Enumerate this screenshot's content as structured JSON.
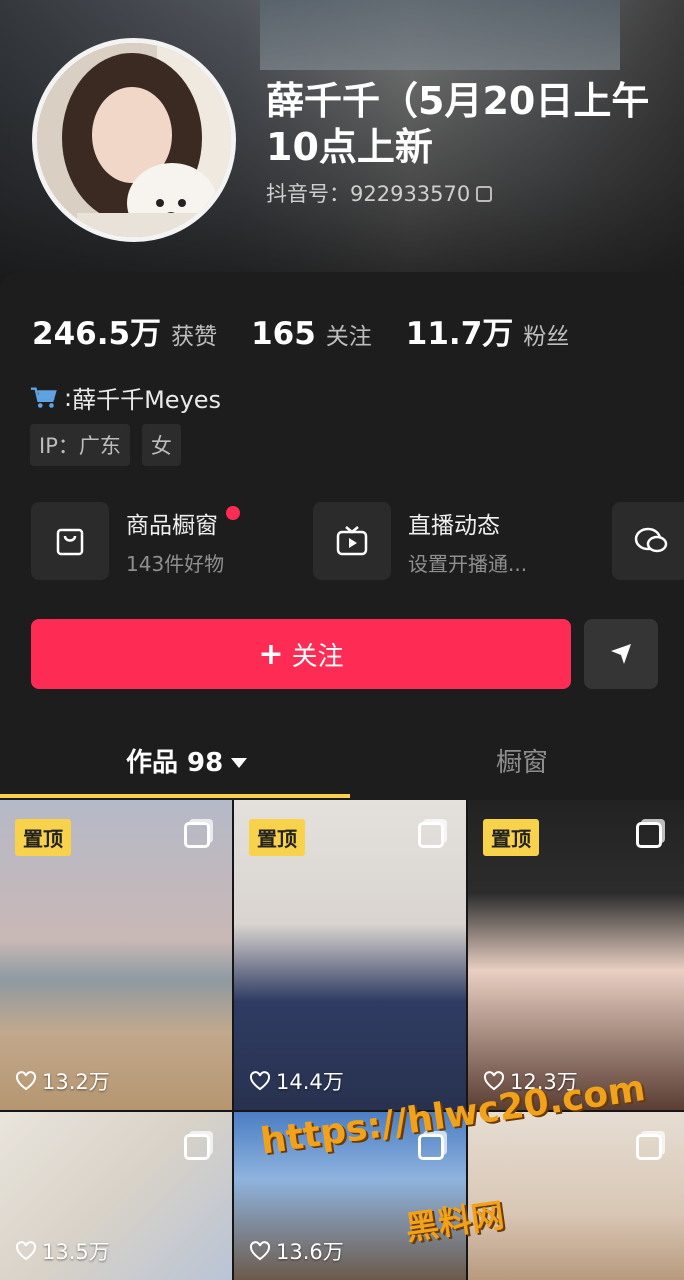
{
  "profile": {
    "name": "薛千千（5月20日上午10点上新",
    "douyin_id": "抖音号：922933570"
  },
  "stats": [
    {
      "value": "246.5万",
      "label": "获赞"
    },
    {
      "value": "165",
      "label": "关注"
    },
    {
      "value": "11.7万",
      "label": "粉丝"
    }
  ],
  "shop": {
    "prefix": ": ",
    "name": "薛千千Meyes"
  },
  "tags": [
    "IP：广东",
    "女"
  ],
  "cards": [
    {
      "title": "商品橱窗",
      "subtitle": "143件好物",
      "icon": "shopping-bag-icon"
    },
    {
      "title": "直播动态",
      "subtitle": "设置开播通...",
      "icon": "tv-icon"
    }
  ],
  "actions": {
    "follow_label": "关注"
  },
  "tabs": {
    "works": "作品 98",
    "window": "橱窗"
  },
  "videos": [
    {
      "pinned": "置顶",
      "likes": "13.2万"
    },
    {
      "pinned": "置顶",
      "likes": "14.4万"
    },
    {
      "pinned": "置顶",
      "likes": "12.3万"
    },
    {
      "pinned": "",
      "likes": "13.5万"
    },
    {
      "pinned": "",
      "likes": "13.6万"
    },
    {
      "pinned": "",
      "likes": ""
    }
  ],
  "watermark": {
    "url": "https://hlwc20.com",
    "name": "黑料网"
  },
  "colors": {
    "accent": "#fe2c55",
    "pin": "#f7d24a",
    "background": "#1d1d1d"
  }
}
